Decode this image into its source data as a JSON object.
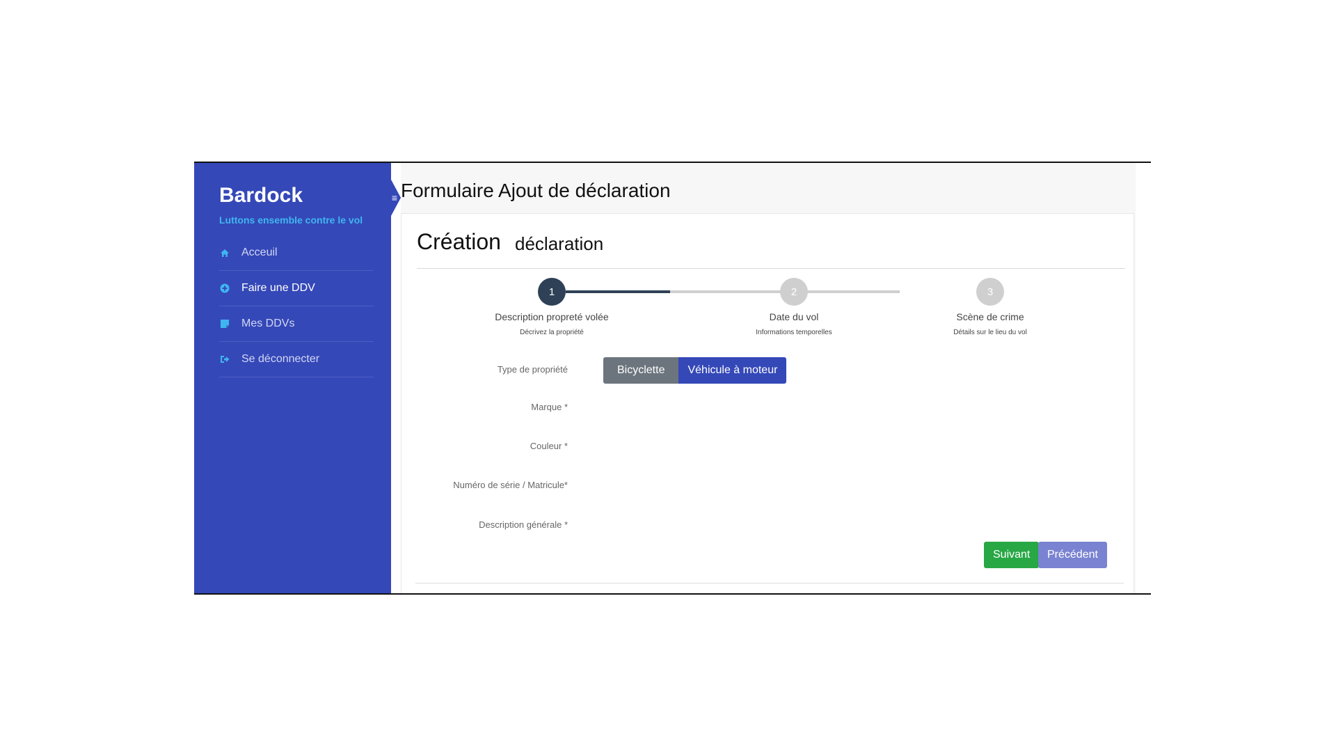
{
  "sidebar": {
    "brand": "Bardock",
    "tagline": "Luttons ensemble contre le vol",
    "items": [
      {
        "label": "Acceuil",
        "icon": "home-icon"
      },
      {
        "label": "Faire une DDV",
        "icon": "plus-circle-icon"
      },
      {
        "label": "Mes DDVs",
        "icon": "note-icon"
      },
      {
        "label": "Se déconnecter",
        "icon": "sign-out-icon"
      }
    ],
    "toggle_glyph": "≡"
  },
  "header": {
    "title": "Formulaire Ajout de déclaration"
  },
  "card": {
    "title_main": "Création",
    "title_sub": "déclaration"
  },
  "stepper": {
    "steps": [
      {
        "number": "1",
        "title": "Description propreté volée",
        "subtitle": "Décrivez la propriété"
      },
      {
        "number": "2",
        "title": "Date du vol",
        "subtitle": "Informations temporelles"
      },
      {
        "number": "3",
        "title": "Scène de crime",
        "subtitle": "Détails sur le lieu du vol"
      }
    ]
  },
  "form": {
    "type_label": "Type de propriété",
    "type_options": [
      "Bicyclette",
      "Véhicule à moteur"
    ],
    "selected_type": "Véhicule à moteur",
    "fields": [
      "Marque *",
      "Couleur *",
      "Numéro de série / Matricule*",
      "Description générale *"
    ]
  },
  "actions": {
    "next": "Suivant",
    "previous": "Précédent"
  },
  "colors": {
    "sidebar": "#3548b8",
    "tagline": "#3fb6f0",
    "step_active": "#2e4156",
    "step_inactive": "#cfcfcf",
    "next_button": "#28a745",
    "prev_button": "#7a83d1"
  }
}
